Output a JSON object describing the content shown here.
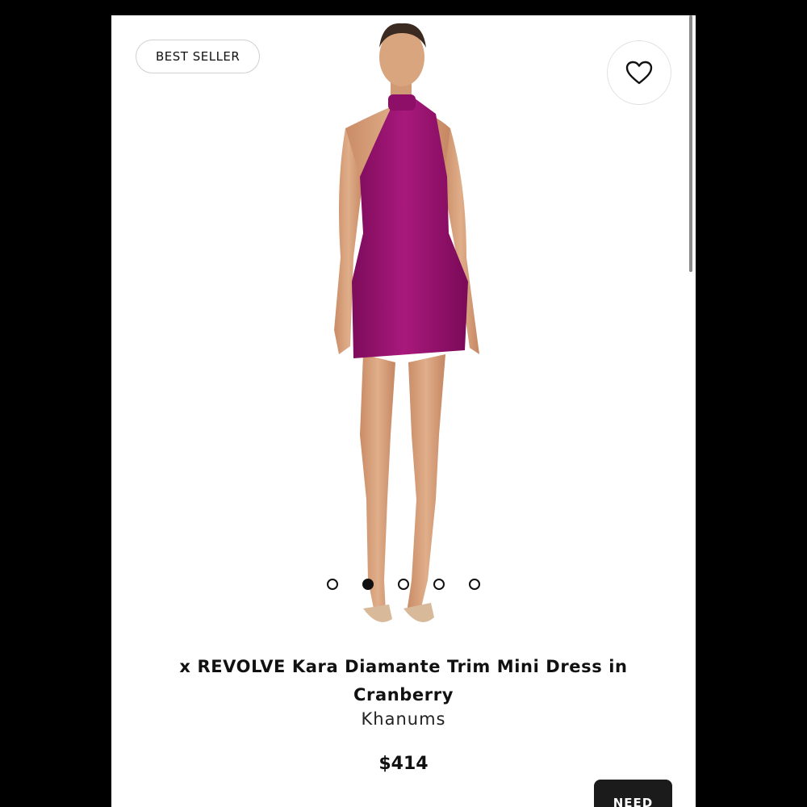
{
  "badge": {
    "label": "BEST SELLER"
  },
  "favorite": {
    "icon": "heart-outline-icon"
  },
  "gallery": {
    "image_desc": "",
    "dots": [
      {
        "active": false
      },
      {
        "active": true
      },
      {
        "active": false
      },
      {
        "active": false
      },
      {
        "active": false
      }
    ]
  },
  "product": {
    "title": "x REVOLVE Kara Diamante Trim Mini Dress in Cranberry",
    "brand": "Khanums",
    "price": "$414"
  },
  "help_button": {
    "label": "NEED"
  },
  "colors": {
    "dress": "#9a1370",
    "skin": "#d9a57f",
    "hair": "#3a2a20",
    "help_button_bg": "#1b1b1b"
  }
}
